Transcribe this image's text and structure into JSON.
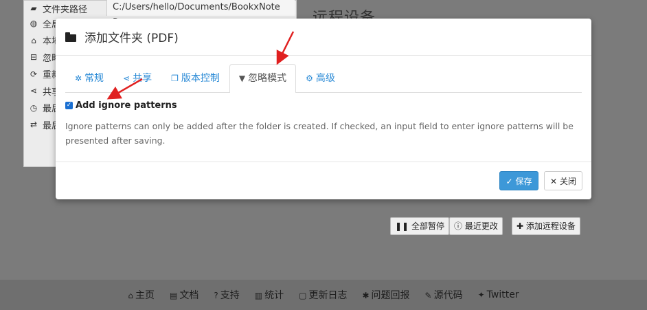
{
  "background": {
    "path_label": "文件夹路径",
    "path_value": "C:/Users/hello/Documents/BookxNote Pro",
    "rows": [
      {
        "icon": "globe-icon",
        "glyph": "◍",
        "label": "全局"
      },
      {
        "icon": "home-icon",
        "glyph": "⌂",
        "label": "本地"
      },
      {
        "icon": "square-minus-icon",
        "glyph": "⊟",
        "label": "忽略"
      },
      {
        "icon": "refresh-icon",
        "glyph": "⟳",
        "label": "重新"
      },
      {
        "icon": "share-icon",
        "glyph": "⋖",
        "label": "共享"
      },
      {
        "icon": "clock-icon",
        "glyph": "◷",
        "label": "最后"
      },
      {
        "icon": "exchange-icon",
        "glyph": "⇄",
        "label": "最后"
      }
    ],
    "heading": "远程设备",
    "buttons": {
      "pause_all": "全部暂停",
      "recent_changes": "最近更改",
      "add_remote": "添加远程设备"
    }
  },
  "footer": {
    "links": [
      {
        "icon": "home-icon",
        "glyph": "⌂",
        "label": "主页"
      },
      {
        "icon": "book-icon",
        "glyph": "▤",
        "label": "文档"
      },
      {
        "icon": "question-icon",
        "glyph": "?",
        "label": "支持"
      },
      {
        "icon": "bar-chart-icon",
        "glyph": "▥",
        "label": "统计"
      },
      {
        "icon": "file-icon",
        "glyph": "▢",
        "label": "更新日志"
      },
      {
        "icon": "bug-icon",
        "glyph": "✱",
        "label": "问题回报"
      },
      {
        "icon": "wrench-icon",
        "glyph": "✎",
        "label": "源代码"
      },
      {
        "icon": "twitter-icon",
        "glyph": "✦",
        "label": "Twitter"
      }
    ]
  },
  "modal": {
    "title": "添加文件夹 (PDF)",
    "tabs": [
      {
        "icon": "gear-icon",
        "glyph": "✲",
        "label": "常规",
        "active": false
      },
      {
        "icon": "share-icon",
        "glyph": "⋖",
        "label": "共享",
        "active": false
      },
      {
        "icon": "copy-icon",
        "glyph": "❐",
        "label": "版本控制",
        "active": false
      },
      {
        "icon": "filter-icon",
        "glyph": "▼",
        "label": "忽略模式",
        "active": true
      },
      {
        "icon": "cogs-icon",
        "glyph": "⚙",
        "label": "高级",
        "active": false
      }
    ],
    "checkbox_label": "Add ignore patterns",
    "checkbox_checked": true,
    "help_text": "Ignore patterns can only be added after the folder is created. If checked, an input field to enter ignore patterns will be presented after saving.",
    "save_label": "保存",
    "close_label": "关闭"
  },
  "colors": {
    "accent": "#2a8ad6",
    "save_button": "#3d98d8",
    "arrow": "#e02020"
  }
}
